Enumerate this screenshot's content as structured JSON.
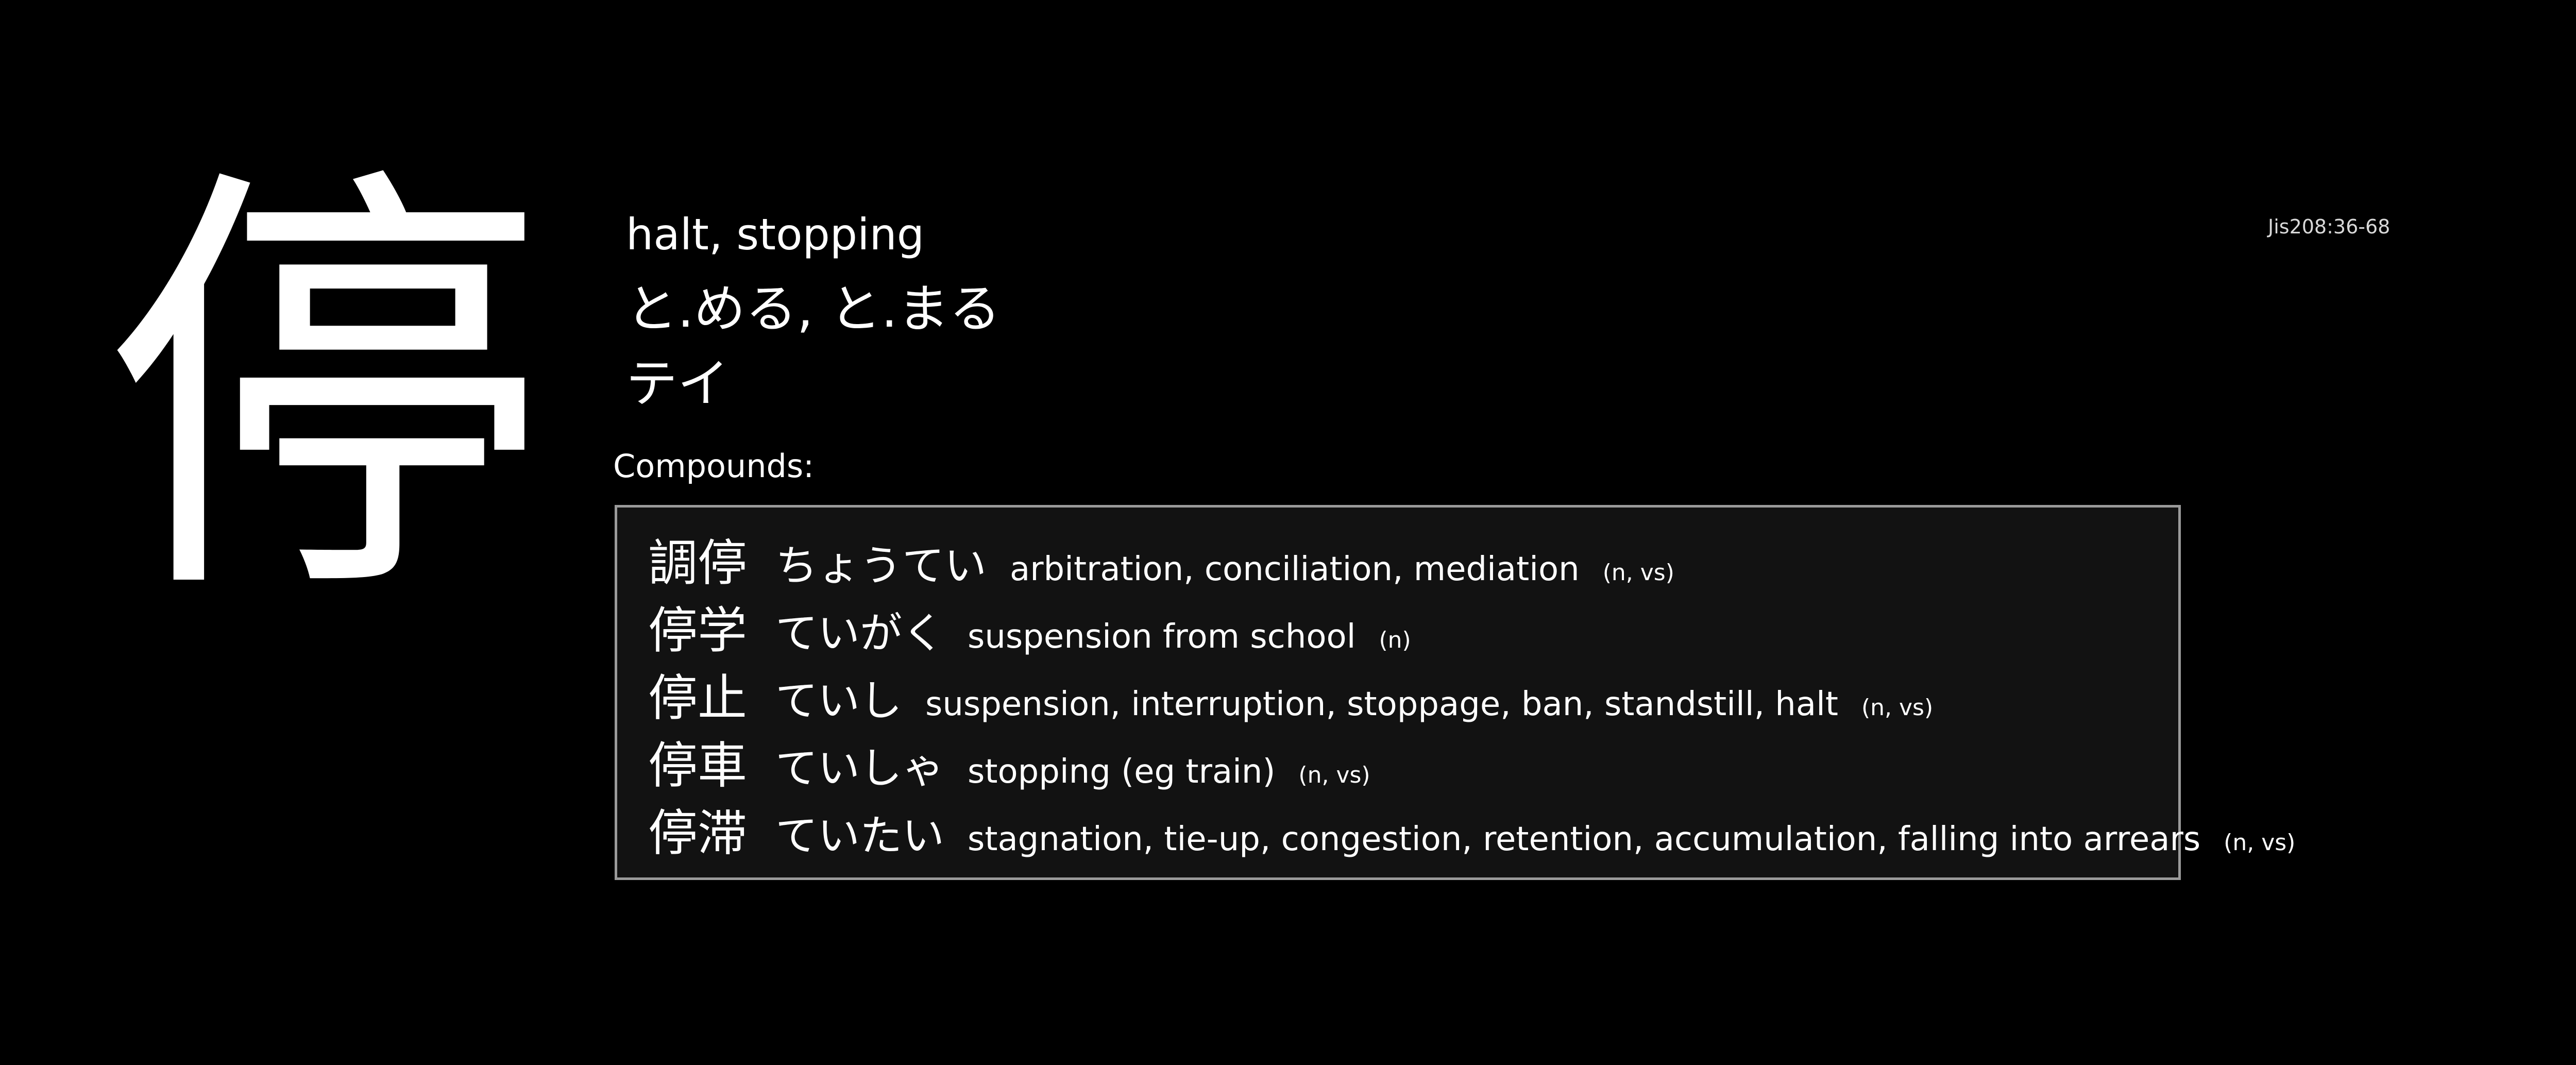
{
  "kanji": "停",
  "meaning": "halt, stopping",
  "kun_reading": "と.める, と.まる",
  "on_reading": "テイ",
  "jis_code": "Jis208:36-68",
  "compounds_label": "Compounds:",
  "compounds": [
    {
      "word": "調停",
      "reading": "ちょうてい",
      "gloss": "arbitration, conciliation, mediation",
      "pos": "(n, vs)"
    },
    {
      "word": "停学",
      "reading": "ていがく",
      "gloss": "suspension from school",
      "pos": "(n)"
    },
    {
      "word": "停止",
      "reading": "ていし",
      "gloss": "suspension, interruption, stoppage, ban, standstill, halt",
      "pos": "(n, vs)"
    },
    {
      "word": "停車",
      "reading": "ていしゃ",
      "gloss": "stopping (eg train)",
      "pos": "(n, vs)"
    },
    {
      "word": "停滞",
      "reading": "ていたい",
      "gloss": "stagnation, tie-up, congestion, retention, accumulation, falling into arrears",
      "pos": "(n, vs)"
    }
  ],
  "colors": {
    "background": "#000000",
    "text": "#ffffff",
    "box_background": "#121212",
    "box_border": "#9a9a9a"
  }
}
